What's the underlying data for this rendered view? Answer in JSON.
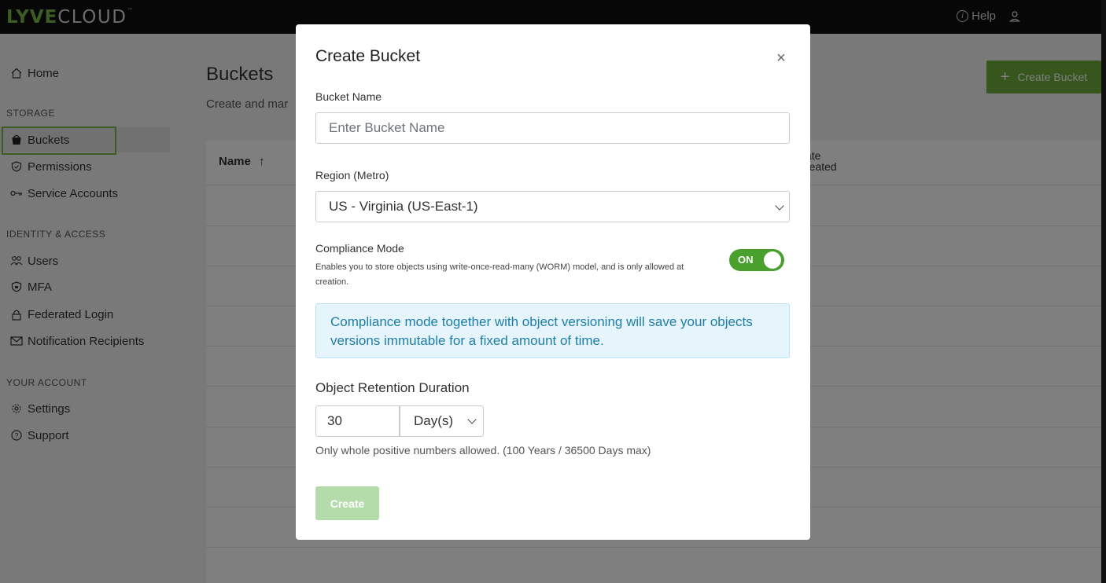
{
  "brand": {
    "lyve": "LYVE",
    "cloud": "CLOUD",
    "tm": "™"
  },
  "header": {
    "help_label": "Help",
    "help_icon": "info-icon",
    "user_icon": "user-icon"
  },
  "sidebar": {
    "home": "Home",
    "storage_section": "STORAGE",
    "buckets": "Buckets",
    "permissions": "Permissions",
    "service_accounts": "Service Accounts",
    "identity_section": "IDENTITY & ACCESS",
    "users": "Users",
    "mfa": "MFA",
    "federated_login": "Federated Login",
    "notification_recipients": "Notification Recipients",
    "account_section": "YOUR ACCOUNT",
    "settings": "Settings",
    "support": "Support"
  },
  "main": {
    "title": "Buckets",
    "subtitle": "Create and mar",
    "create_bucket_label": "Create Bucket",
    "table": {
      "col_name": "Name",
      "col_name_sort": "↑",
      "col_date_line1": "ate",
      "col_date_line2": "reated"
    }
  },
  "modal": {
    "title": "Create Bucket",
    "close": "×",
    "bucket_name_label": "Bucket Name",
    "bucket_name_placeholder": "Enter Bucket Name",
    "region_label": "Region (Metro)",
    "region_value": "US - Virginia (US-East-1)",
    "compliance_title": "Compliance Mode",
    "compliance_desc": "Enables you to store objects using write-once-read-many (WORM) model, and is only allowed at creation.",
    "compliance_toggle": "ON",
    "info_text": "Compliance mode together with object versioning will save your objects versions immutable for a fixed amount of time.",
    "retention_label": "Object Retention Duration",
    "retention_value": "30",
    "retention_unit": "Day(s)",
    "retention_hint": "Only whole positive numbers allowed. (100 Years / 36500 Days max)",
    "create_label": "Create"
  },
  "colors": {
    "accent": "#6cac3a",
    "toggle_on": "#4aa02c",
    "info_text": "#1f7da8",
    "info_bg": "#e5f5fb"
  }
}
